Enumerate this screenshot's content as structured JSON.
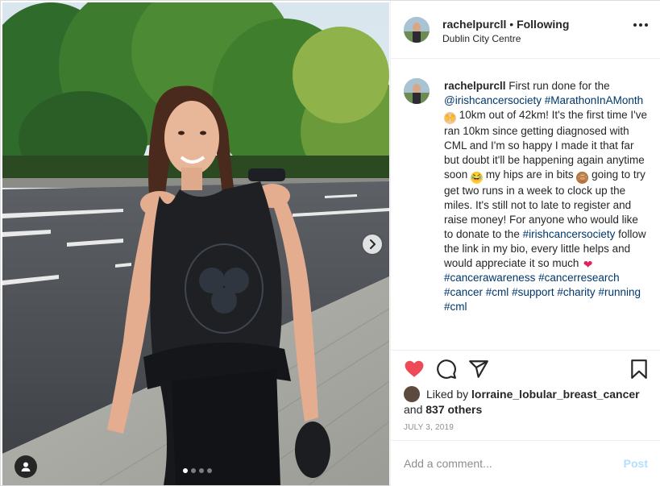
{
  "header": {
    "username": "rachelpurcll",
    "separator": "•",
    "follow_status": "Following",
    "location": "Dublin City Centre"
  },
  "caption": {
    "username": "rachelpurcll",
    "text_1": "First run done for the",
    "tag_1": "@irishcancersociety",
    "tag_2": "#MarathonInAMonth",
    "text_2": "10km out of 42km! It's the first time I've ran 10km since getting diagnosed with CML and I'm so happy I made it that far but doubt it'll be happening again anytime soon",
    "text_3": "my hips are in bits",
    "text_4": "going to try get two runs in a week to clock up the miles. It's still not to late to register and raise money! For anyone who would like to donate to the",
    "tag_3": "#irishcancersociety",
    "text_5": "follow the link in my bio, every little helps and would appreciate it so much",
    "hashtags": [
      "#cancerawareness",
      "#cancerresearch",
      "#cancer",
      "#cml",
      "#support",
      "#charity",
      "#running",
      "#cml"
    ]
  },
  "icons": {
    "like": "heart-icon",
    "comment": "comment-icon",
    "share": "send-icon",
    "save": "bookmark-icon",
    "like_color": "#ed4956"
  },
  "likes": {
    "prefix": "Liked by",
    "user": "lorraine_lobular_breast_cancer",
    "and": "and",
    "others": "837 others"
  },
  "date": "JULY 3, 2019",
  "comment": {
    "placeholder": "Add a comment...",
    "post_label": "Post"
  },
  "carousel": {
    "total": 4,
    "active": 1
  }
}
